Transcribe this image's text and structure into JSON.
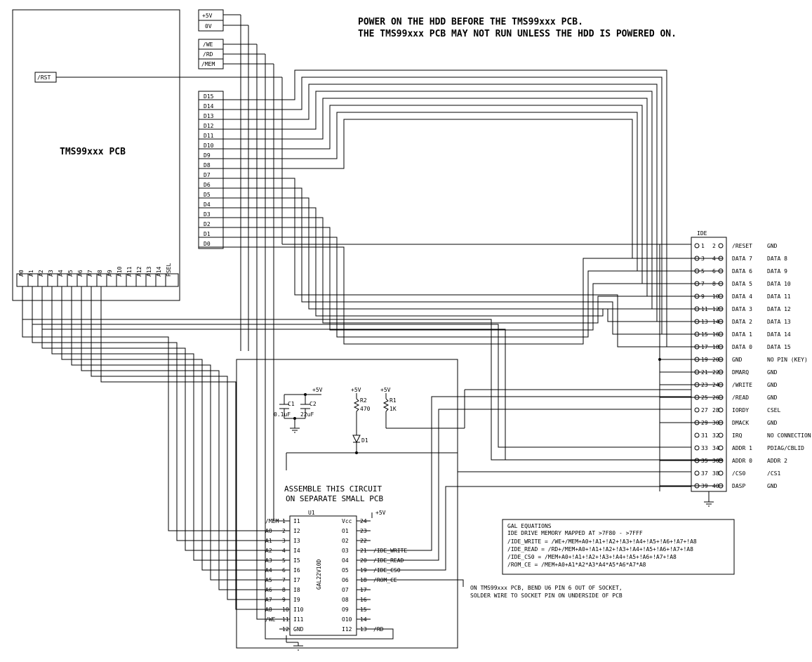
{
  "warning": {
    "l1": "POWER ON THE HDD BEFORE THE TMS99xxx PCB.",
    "l2": "THE TMS99xxx PCB MAY NOT RUN UNLESS THE HDD IS POWERED ON."
  },
  "pcb": {
    "title": "TMS99xxx PCB",
    "power": {
      "p5": "+5V",
      "zero": "0V"
    },
    "ctl": {
      "we": "/WE",
      "rd": "/RD",
      "mem": "/MEM",
      "rst": "/RST"
    },
    "data": [
      "D15",
      "D14",
      "D13",
      "D12",
      "D11",
      "D10",
      "D9",
      "D8",
      "D7",
      "D6",
      "D5",
      "D4",
      "D3",
      "D2",
      "D1",
      "D0"
    ],
    "addr": [
      "A0",
      "A1",
      "A2",
      "A3",
      "A4",
      "A5",
      "A6",
      "A7",
      "A8",
      "A9",
      "A10",
      "A11",
      "A12",
      "A13",
      "A14",
      "PSEL"
    ]
  },
  "subpcb": {
    "title1": "ASSEMBLE THIS CIRCUIT",
    "title2": "ON SEPARATE SMALL PCB",
    "caps": {
      "c1": "C1",
      "c1v": "0.1uF",
      "c2": "C2",
      "c2v": "22uF",
      "p5": "+5V"
    },
    "res": {
      "r1": "R1",
      "r1v": "1K",
      "r2": "R2",
      "r2v": "470",
      "p5": "+5V",
      "d1": "D1"
    },
    "gal": {
      "ref": "U1",
      "type": "GAL22V10D",
      "left": [
        [
          "/MEM",
          "1",
          "I1"
        ],
        [
          "A0",
          "2",
          "I2"
        ],
        [
          "A1",
          "3",
          "I3"
        ],
        [
          "A2",
          "4",
          "I4"
        ],
        [
          "A3",
          "5",
          "I5"
        ],
        [
          "A4",
          "6",
          "I6"
        ],
        [
          "A5",
          "7",
          "I7"
        ],
        [
          "A6",
          "8",
          "I8"
        ],
        [
          "A7",
          "9",
          "I9"
        ],
        [
          "A8",
          "10",
          "I10"
        ],
        [
          "/WE",
          "11",
          "I11"
        ],
        [
          "",
          "12",
          "GND"
        ]
      ],
      "right": [
        [
          "Vcc",
          "24",
          ""
        ],
        [
          "O1",
          "23",
          ""
        ],
        [
          "O2",
          "22",
          ""
        ],
        [
          "O3",
          "21",
          "/IDE_WRITE"
        ],
        [
          "O4",
          "20",
          "/IDE_READ"
        ],
        [
          "O5",
          "19",
          "/IDE_CS0"
        ],
        [
          "O6",
          "18",
          "/ROM_CE"
        ],
        [
          "O7",
          "17",
          ""
        ],
        [
          "O8",
          "16",
          ""
        ],
        [
          "O9",
          "15",
          ""
        ],
        [
          "O10",
          "14",
          ""
        ],
        [
          "I12",
          "13",
          "/RD"
        ]
      ]
    }
  },
  "ide": {
    "title": "IDE",
    "rows": [
      [
        "1",
        "2",
        "/RESET",
        "GND"
      ],
      [
        "3",
        "4",
        "DATA 7",
        "DATA 8"
      ],
      [
        "5",
        "6",
        "DATA 6",
        "DATA 9"
      ],
      [
        "7",
        "8",
        "DATA 5",
        "DATA 10"
      ],
      [
        "9",
        "10",
        "DATA 4",
        "DATA 11"
      ],
      [
        "11",
        "12",
        "DATA 3",
        "DATA 12"
      ],
      [
        "13",
        "14",
        "DATA 2",
        "DATA 13"
      ],
      [
        "15",
        "16",
        "DATA 1",
        "DATA 14"
      ],
      [
        "17",
        "18",
        "DATA 0",
        "DATA 15"
      ],
      [
        "19",
        "20",
        "GND",
        "NO PIN (KEY)"
      ],
      [
        "21",
        "22",
        "DMARQ",
        "GND"
      ],
      [
        "23",
        "24",
        "/WRITE",
        "GND"
      ],
      [
        "25",
        "26",
        "/READ",
        "GND"
      ],
      [
        "27",
        "28",
        "IORDY",
        "CSEL"
      ],
      [
        "29",
        "30",
        "DMACK",
        "GND"
      ],
      [
        "31",
        "32",
        "IRQ",
        "NO CONNECTION"
      ],
      [
        "33",
        "34",
        "ADDR 1",
        "PDIAG/CBLID"
      ],
      [
        "35",
        "36",
        "ADDR 0",
        "ADDR 2"
      ],
      [
        "37",
        "38",
        "/CS0",
        "/CS1"
      ],
      [
        "39",
        "40",
        "DASP",
        "GND"
      ]
    ]
  },
  "galeq": {
    "title": "GAL EQUATIONS",
    "sub": "IDE DRIVE MEMORY MAPPED AT >7F80 - >7FFF",
    "eq": [
      "/IDE_WRITE = /WE+/MEM+A0+!A1+!A2+!A3+!A4+!A5+!A6+!A7+!A8",
      "/IDE_READ  = /RD+/MEM+A0+!A1+!A2+!A3+!A4+!A5+!A6+!A7+!A8",
      "/IDE_CS0   = /MEM+A0+!A1+!A2+!A3+!A4+!A5+!A6+!A7+!A8",
      "/ROM_CE    = /MEM+A0+A1*A2*A3*A4*A5*A6*A7*A8"
    ]
  },
  "note": {
    "l1": "ON TMS99xxx PCB, BEND U6 PIN 6 OUT OF SOCKET,",
    "l2": "SOLDER WIRE TO SOCKET PIN ON UNDERSIDE OF PCB"
  }
}
